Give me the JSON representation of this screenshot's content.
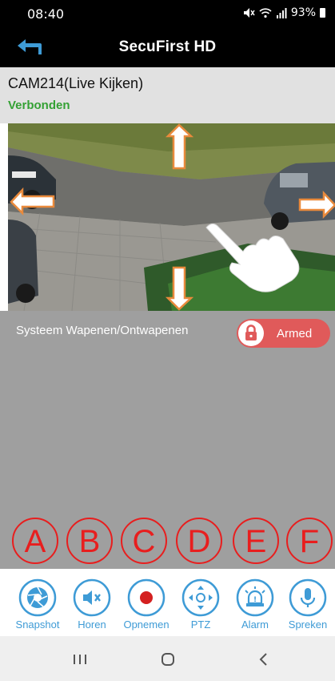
{
  "status_bar": {
    "time": "08:40",
    "battery": "93%",
    "icons": [
      "mute-icon",
      "wifi-icon",
      "signal-icon",
      "battery-icon"
    ]
  },
  "header": {
    "title": "SecuFirst HD",
    "back_icon": "back-arrow-icon"
  },
  "camera": {
    "name": "CAM214(Live Kijken)",
    "status": "Verbonden",
    "status_color": "#34a134"
  },
  "arm": {
    "label": "Systeem Wapenen/Ontwapenen",
    "toggle_text": "Armed",
    "toggle_color": "#e05a5a"
  },
  "annotations": [
    "A",
    "B",
    "C",
    "D",
    "E",
    "F"
  ],
  "toolbar": {
    "items": [
      {
        "label": "Snapshot",
        "icon": "camera-shutter-icon"
      },
      {
        "label": "Horen",
        "icon": "speaker-mute-icon"
      },
      {
        "label": "Opnemen",
        "icon": "record-icon"
      },
      {
        "label": "PTZ",
        "icon": "ptz-direction-icon"
      },
      {
        "label": "Alarm",
        "icon": "alarm-siren-icon"
      },
      {
        "label": "Spreken",
        "icon": "microphone-icon"
      }
    ],
    "accent": "#3e9bd6"
  },
  "nav": {
    "icons": [
      "recent-apps-icon",
      "home-icon",
      "back-icon"
    ]
  }
}
